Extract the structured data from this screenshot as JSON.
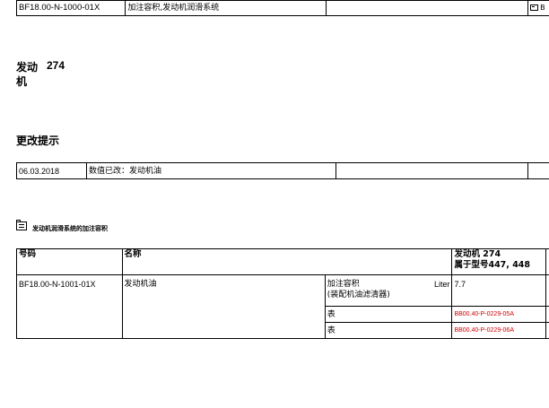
{
  "header": {
    "code": "BF18.00-N-1000-01X",
    "title": "加注容积,发动机润滑系统",
    "ref_mark": "B"
  },
  "engine_title": {
    "line1": "发动",
    "number": "274",
    "line2": "机"
  },
  "change_section": {
    "title": "更改提示",
    "date": "06.03.2018",
    "note": "数值已改：发动机油"
  },
  "fill_section": {
    "title": "发动机润滑系统的加注容积"
  },
  "table": {
    "headers": {
      "code": "号码",
      "name": "名称",
      "engine_line1": "发动机 274",
      "engine_line2": "属于型号447, 448"
    },
    "row": {
      "code": "BF18.00-N-1001-01X",
      "name": "发动机油",
      "capacity_label": "加注容积",
      "unit": "Liter",
      "capacity_note": "(装配机油滤清器)",
      "value": "7.7",
      "table_label_1": "表",
      "table_ref_1": "BB00.40-P-0229-05A",
      "table_label_2": "表",
      "table_ref_2": "BB00.40-P-0229-06A"
    }
  }
}
